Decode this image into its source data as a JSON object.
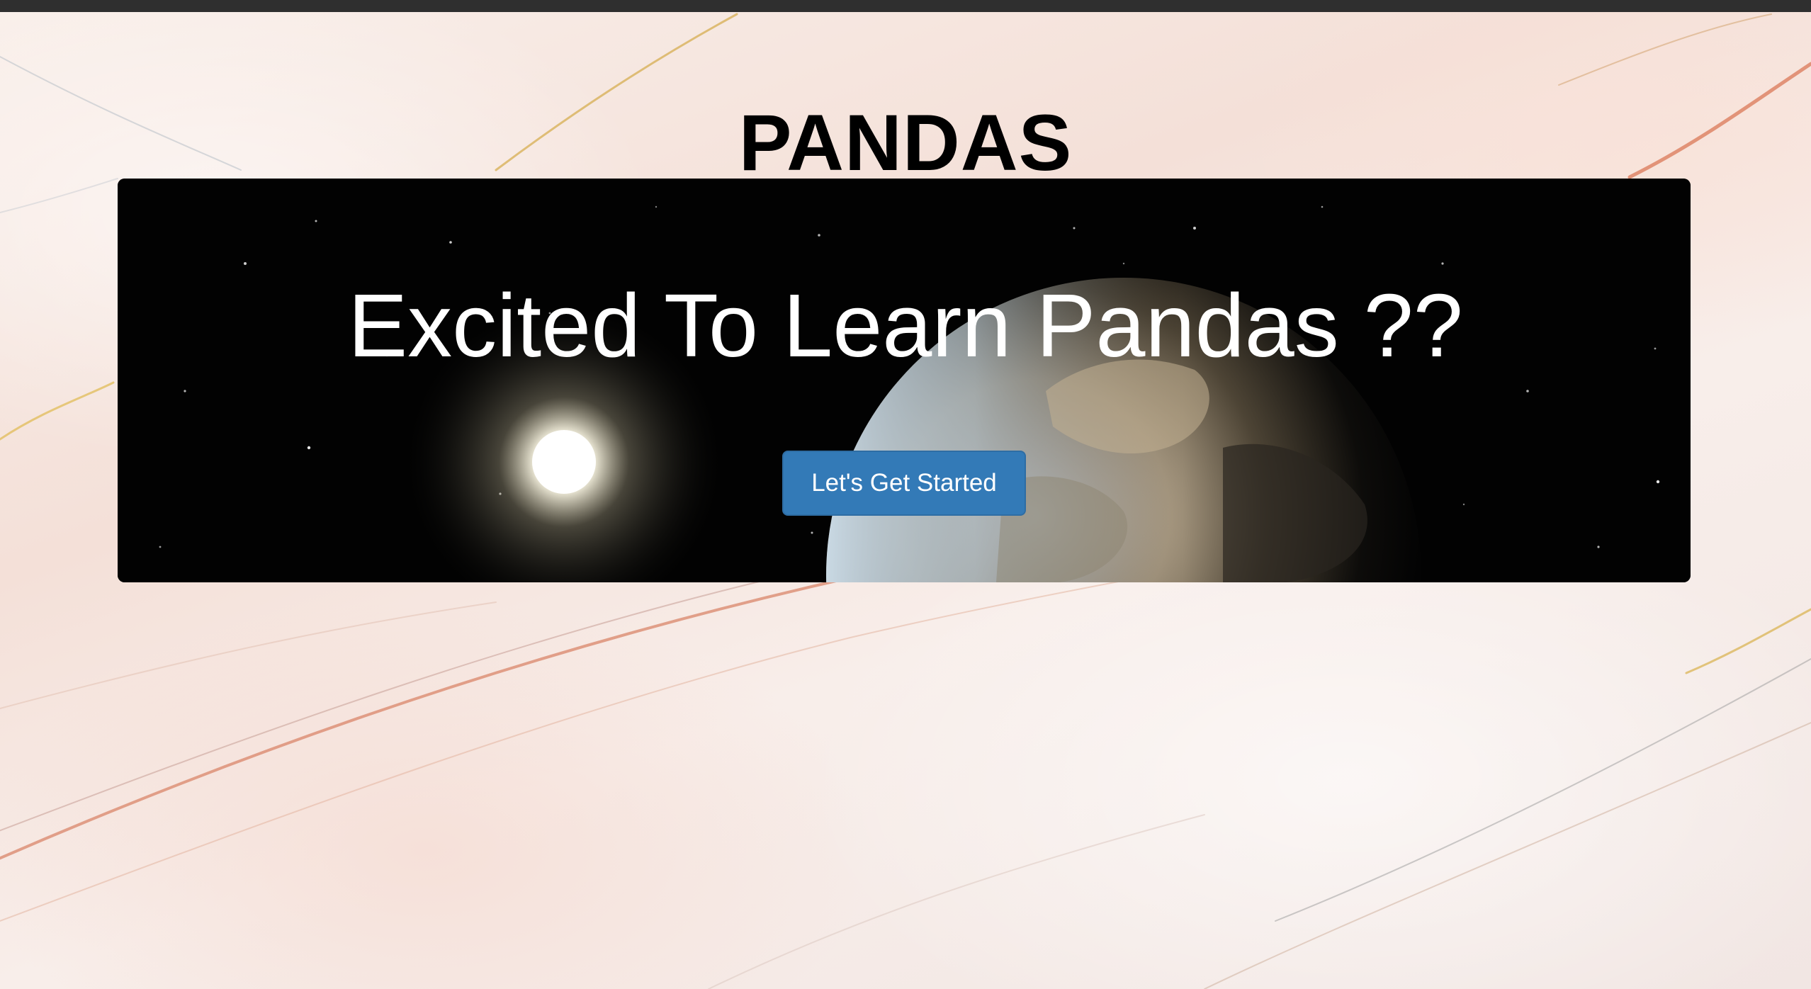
{
  "header": {
    "title": "PANDAS"
  },
  "hero": {
    "heading": "Excited To Learn Pandas ??",
    "cta_label": "Let's Get Started",
    "cta_color": "#337ab7"
  },
  "colors": {
    "title_text": "#000000",
    "hero_background": "#020202",
    "hero_text": "#ffffff",
    "page_background": "#f6ece7"
  }
}
